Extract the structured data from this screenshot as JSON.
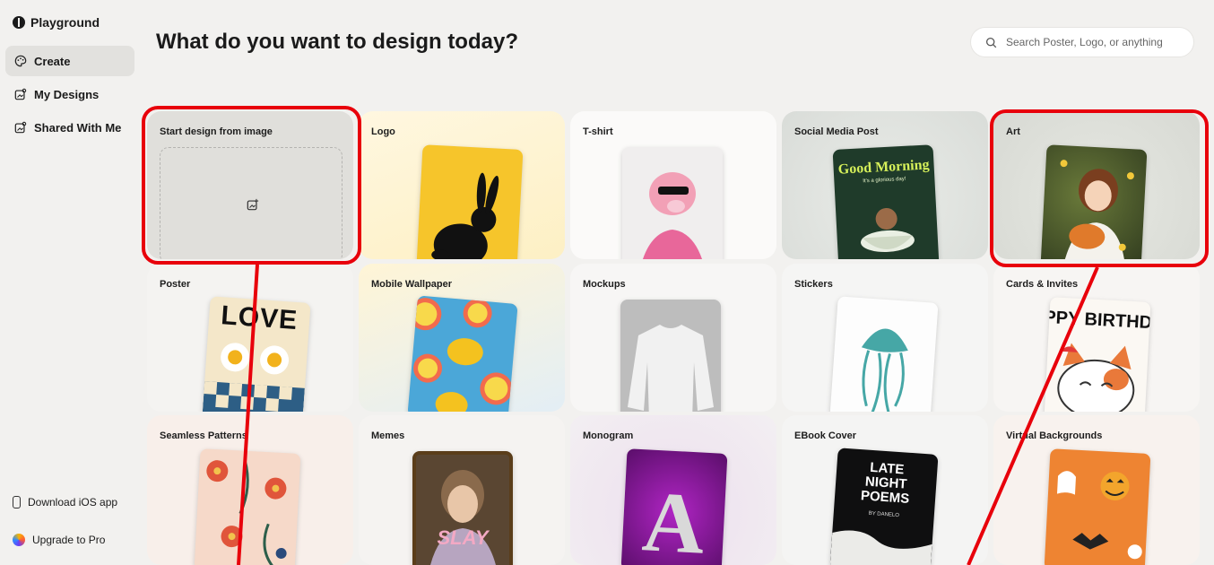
{
  "app": {
    "name": "Playground"
  },
  "sidebar": {
    "items": [
      {
        "label": "Create",
        "icon": "palette-icon",
        "active": true
      },
      {
        "label": "My Designs",
        "icon": "designs-icon",
        "active": false
      },
      {
        "label": "Shared With Me",
        "icon": "shared-icon",
        "active": false
      }
    ],
    "bottom": [
      {
        "label": "Download iOS app",
        "icon": "phone-icon"
      },
      {
        "label": "Upgrade to Pro",
        "icon": "pro-icon"
      }
    ]
  },
  "header": {
    "title": "What do you want to design today?",
    "search_placeholder": "Search Poster, Logo, or anything"
  },
  "cards": [
    {
      "label": "Start design from image",
      "icon": "image-upload-icon"
    },
    {
      "label": "Logo"
    },
    {
      "label": "T-shirt"
    },
    {
      "label": "Social Media Post",
      "thumb_text": "Good Morning",
      "thumb_sub": "It's a glorious day!"
    },
    {
      "label": "Art"
    },
    {
      "label": "Poster",
      "thumb_text": "LOVE"
    },
    {
      "label": "Mobile Wallpaper"
    },
    {
      "label": "Mockups"
    },
    {
      "label": "Stickers"
    },
    {
      "label": "Cards & Invites",
      "thumb_text": "PPY BIRTHD"
    },
    {
      "label": "Seamless Patterns"
    },
    {
      "label": "Memes",
      "thumb_text": "SLAY"
    },
    {
      "label": "Monogram",
      "thumb_text": "A"
    },
    {
      "label": "EBook Cover",
      "thumb_text": "LATE NIGHT POEMS",
      "thumb_sub": "BY DANELO"
    },
    {
      "label": "Virtual Backgrounds"
    }
  ],
  "colors": {
    "annotation": "#e8000b",
    "background": "#f2f1ef"
  }
}
